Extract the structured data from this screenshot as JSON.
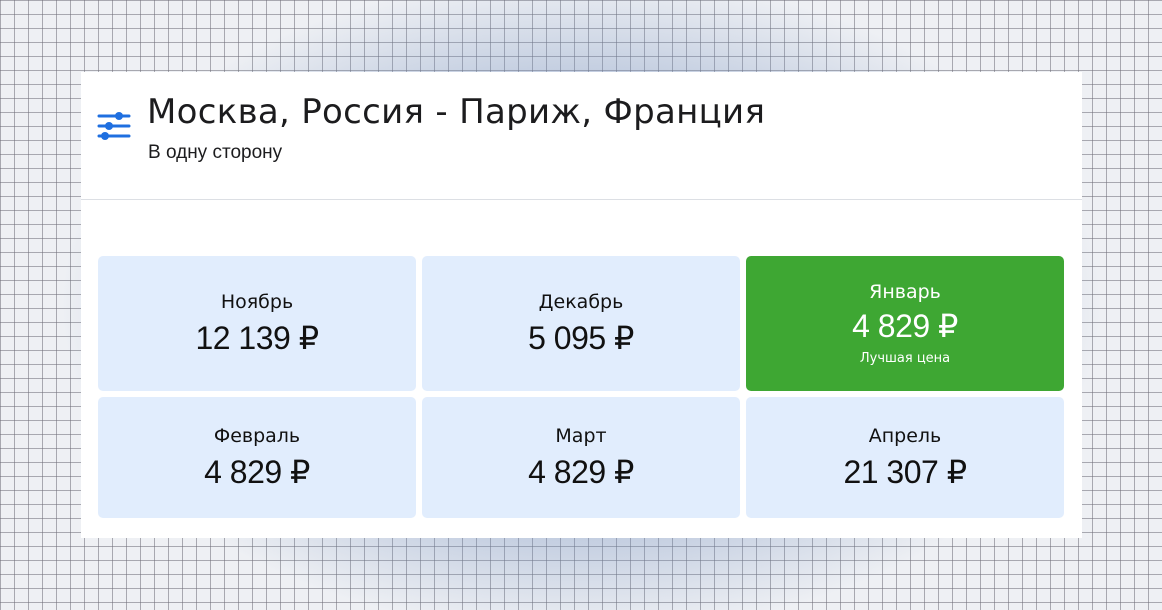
{
  "header": {
    "title": "Москва, Россия - Париж, Франция",
    "subtitle": "В одну сторону",
    "icon": "filter-sliders-icon",
    "accent_color": "#1f6fe0"
  },
  "months": [
    {
      "month": "Ноябрь",
      "price": "12 139 ₽"
    },
    {
      "month": "Декабрь",
      "price": "5 095 ₽"
    },
    {
      "month": "Январь",
      "price": "4 829 ₽",
      "badge": "Лучшая цена"
    },
    {
      "month": "Февраль",
      "price": "4 829 ₽"
    },
    {
      "month": "Март",
      "price": "4 829 ₽"
    },
    {
      "month": "Апрель",
      "price": "21 307 ₽"
    }
  ],
  "colors": {
    "cell_background": "#e1edfd",
    "best_price_background": "#3ea733"
  }
}
